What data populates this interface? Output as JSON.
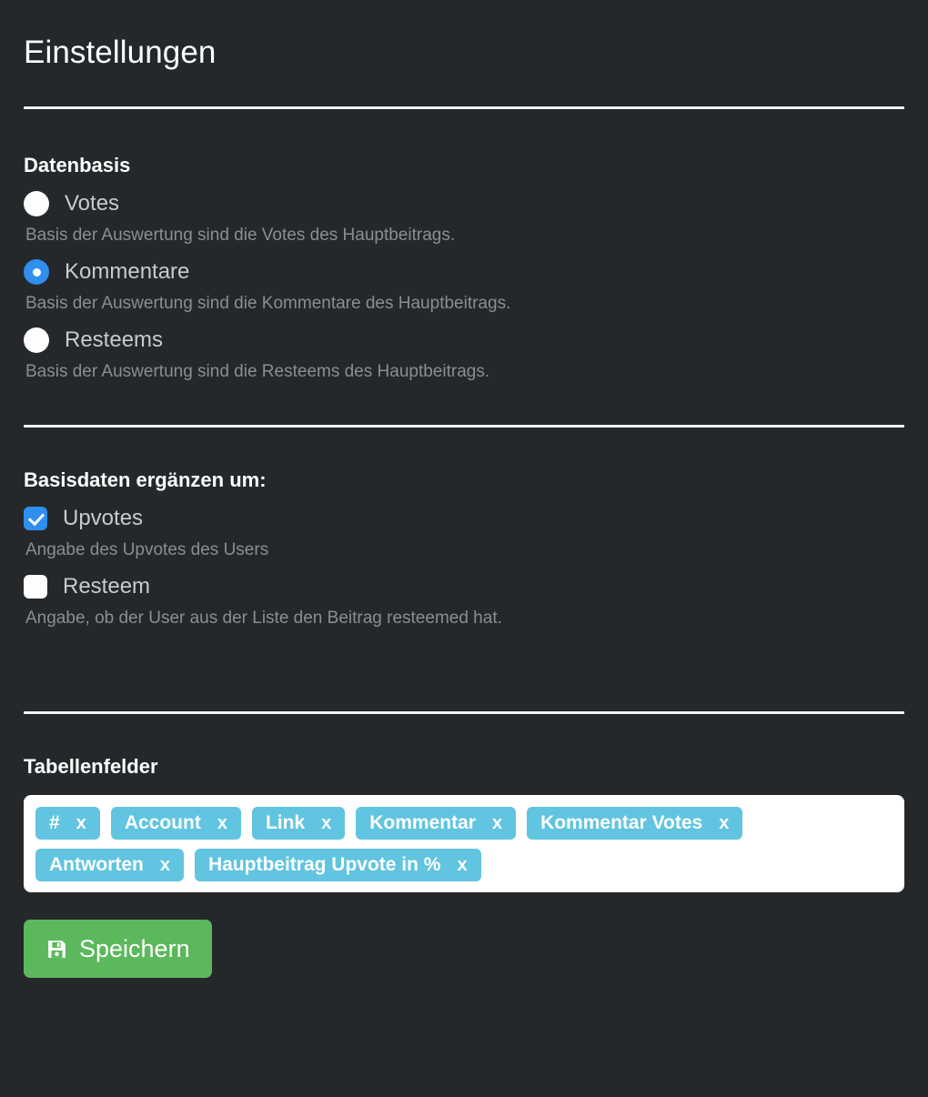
{
  "page": {
    "title": "Einstellungen"
  },
  "datenbasis": {
    "heading": "Datenbasis",
    "options": [
      {
        "label": "Votes",
        "description": "Basis der Auswertung sind die Votes des Hauptbeitrags.",
        "selected": false
      },
      {
        "label": "Kommentare",
        "description": "Basis der Auswertung sind die Kommentare des Hauptbeitrags.",
        "selected": true
      },
      {
        "label": "Resteems",
        "description": "Basis der Auswertung sind die Resteems des Hauptbeitrags.",
        "selected": false
      }
    ]
  },
  "erganzen": {
    "heading": "Basisdaten ergänzen um:",
    "options": [
      {
        "label": "Upvotes",
        "description": "Angabe des Upvotes des Users",
        "checked": true
      },
      {
        "label": "Resteem",
        "description": "Angabe, ob der User aus der Liste den Beitrag resteemed hat.",
        "checked": false
      }
    ]
  },
  "tabellenfelder": {
    "heading": "Tabellenfelder",
    "remove_label": "x",
    "chips": [
      {
        "label": "#"
      },
      {
        "label": "Account"
      },
      {
        "label": "Link"
      },
      {
        "label": "Kommentar"
      },
      {
        "label": "Kommentar Votes"
      },
      {
        "label": "Antworten"
      },
      {
        "label": "Hauptbeitrag Upvote in %"
      }
    ]
  },
  "footer": {
    "save_label": "Speichern",
    "save_icon": "save-floppy-icon"
  },
  "colors": {
    "background": "#24282b",
    "accent_blue": "#2f8ff0",
    "chip_blue": "#61c4e0",
    "save_green": "#5cb85c",
    "divider": "#f2f3f3",
    "label_text": "#c8cbcc",
    "description_text": "#8b8e90"
  }
}
